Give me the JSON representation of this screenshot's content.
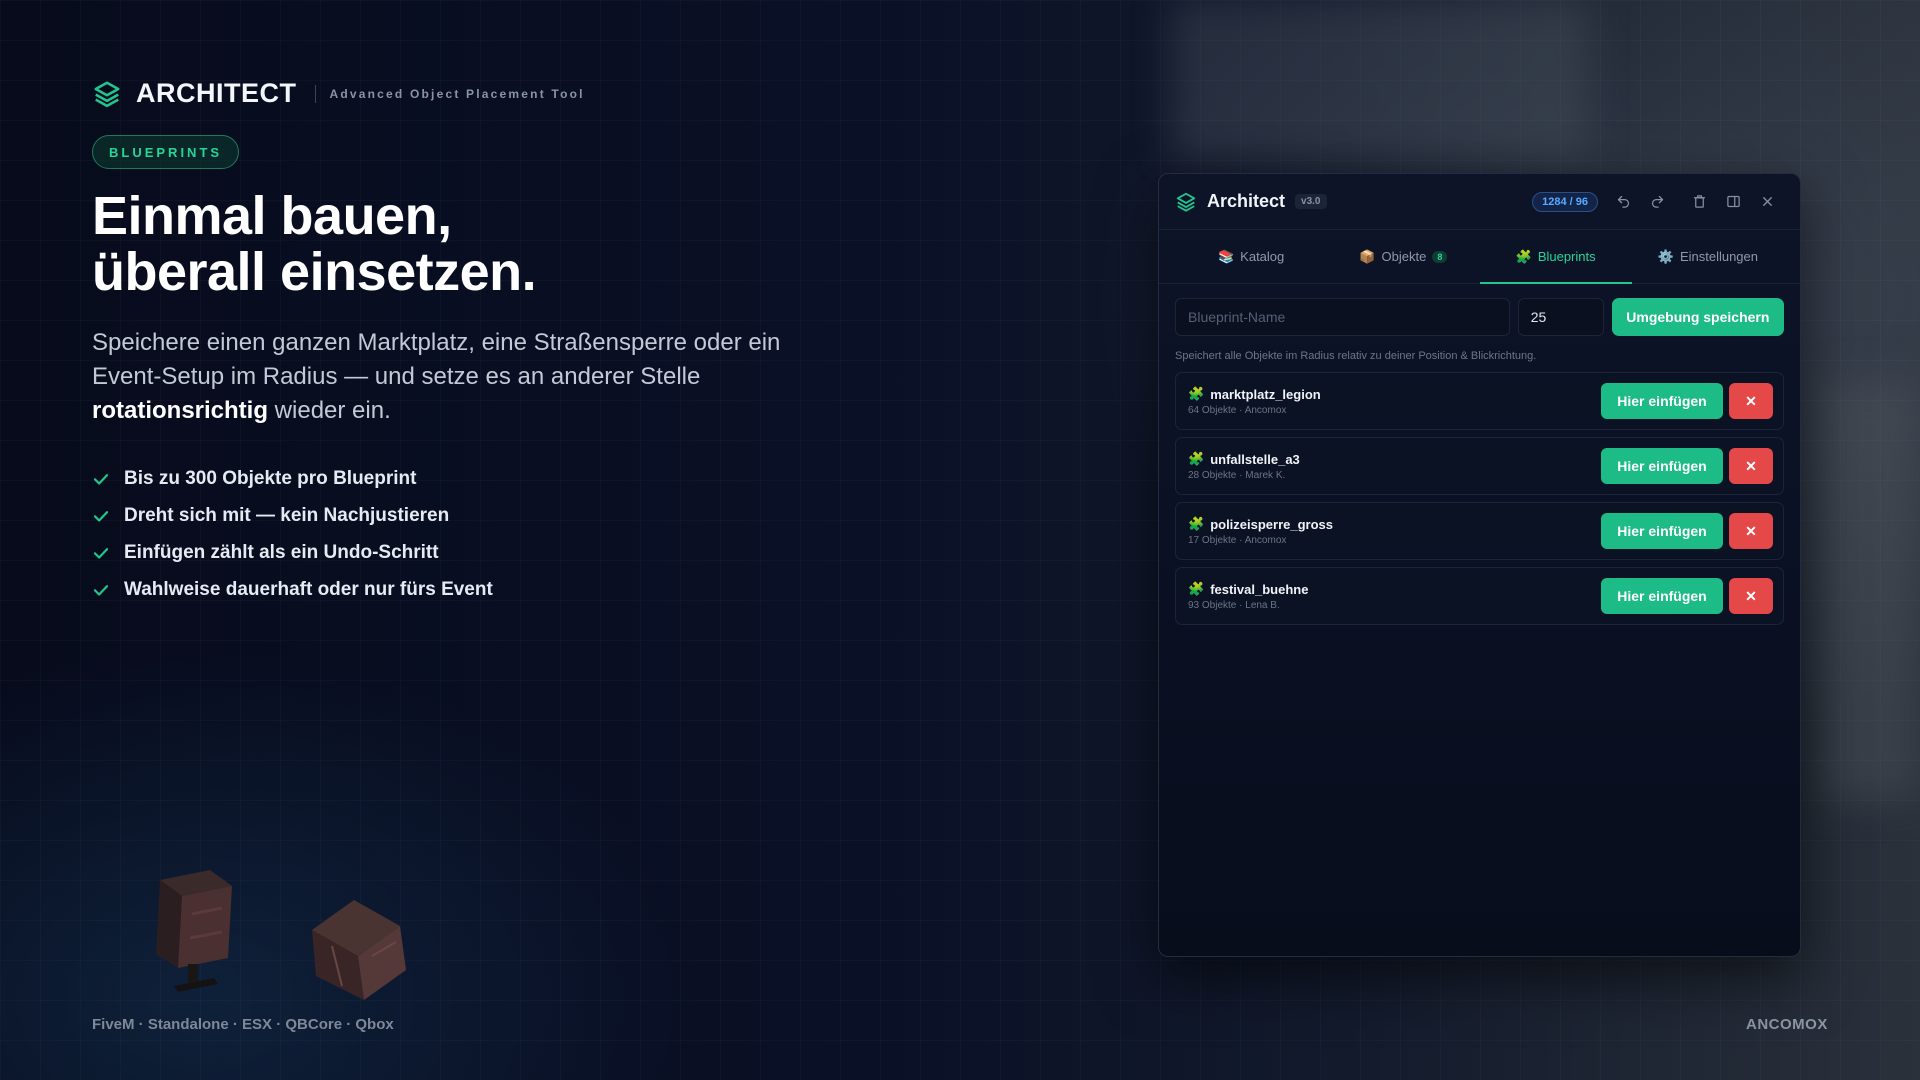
{
  "brand": {
    "title": "ARCHITECT",
    "subtitle": "Advanced Object Placement Tool",
    "accent_color": "#22c58d"
  },
  "pill_label": "BLUEPRINTS",
  "headline": {
    "line1": "Einmal bauen,",
    "line2": "überall einsetzen."
  },
  "lead": {
    "part1": "Speichere einen ganzen Marktplatz, eine Straßensperre oder ein Event-Setup im Radius — und setze es an anderer Stelle ",
    "bold": "rotationsrichtig",
    "part2": " wieder ein."
  },
  "features": [
    "Bis zu 300 Objekte pro Blueprint",
    "Dreht sich mit — kein Nachjustieren",
    "Einfügen zählt als ein Undo-Schritt",
    "Wahlweise dauerhaft oder nur fürs Event"
  ],
  "footer": {
    "platforms": "FiveM · Standalone · ESX · QBCore · Qbox",
    "author": "ANCOMOX"
  },
  "window": {
    "title": "Architect",
    "version": "v3.0",
    "counter": "1284 / 96",
    "icons": [
      "undo-icon",
      "redo-icon",
      "trash-icon",
      "split-view-icon",
      "close-icon"
    ],
    "tabs": [
      {
        "emoji": "📚",
        "label": "Katalog",
        "active": false
      },
      {
        "emoji": "📦",
        "label": "Objekte",
        "badge": "8",
        "active": false
      },
      {
        "emoji": "🧩",
        "label": "Blueprints",
        "active": true
      },
      {
        "emoji": "⚙️",
        "label": "Einstellungen",
        "active": false
      }
    ],
    "name_placeholder": "Blueprint-Name",
    "radius_value": "25",
    "save_label": "Umgebung speichern",
    "hint": "Speichert alle Objekte im Radius relativ zu deiner Position & Blickrichtung.",
    "insert_label": "Hier einfügen",
    "delete_label": "✕",
    "blueprints": [
      {
        "name": "marktplatz_legion",
        "meta": "64 Objekte · Ancomox"
      },
      {
        "name": "unfallstelle_a3",
        "meta": "28 Objekte · Marek K."
      },
      {
        "name": "polizeisperre_gross",
        "meta": "17 Objekte · Ancomox"
      },
      {
        "name": "festival_buehne",
        "meta": "93 Objekte · Lena B."
      }
    ]
  }
}
